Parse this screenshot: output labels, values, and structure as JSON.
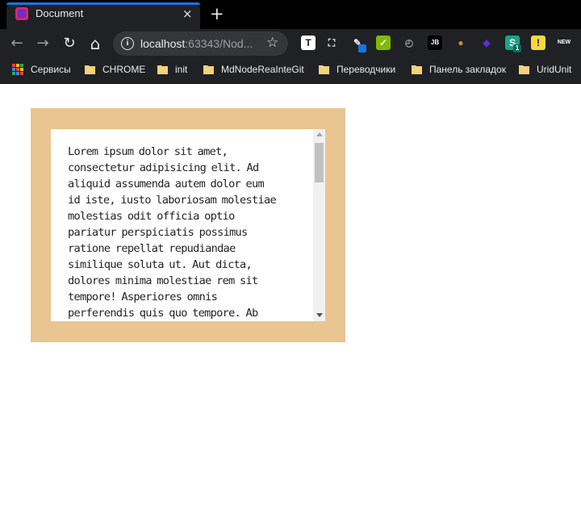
{
  "browser": {
    "tab": {
      "title": "Document",
      "close_icon": "×",
      "favicon": "intellij-icon"
    },
    "new_tab_icon": "+",
    "nav": {
      "back_icon": "←",
      "forward_icon": "→",
      "reload_icon": "↻",
      "home_icon": "⌂"
    },
    "address": {
      "info_icon": "i",
      "host": "localhost",
      "rest": ":63343/Nod...",
      "star_icon": "☆"
    },
    "extensions": [
      {
        "name": "text-extension-icon",
        "color": "#ffffff",
        "glyph": "T",
        "text_color": "#202124"
      },
      {
        "name": "screenshot-extension-icon",
        "color": "#202124",
        "glyph": "⛶",
        "text_color": "#e8eaed"
      },
      {
        "name": "eyedropper-extension-icon",
        "color": "#202124",
        "glyph": "✎",
        "text_color": "#e8eaed",
        "badge": "",
        "badge_color": "#1a73e8"
      },
      {
        "name": "evernote-extension-icon",
        "color": "#7fba00",
        "glyph": "✓",
        "text_color": "#ffffff"
      },
      {
        "name": "clock-extension-icon",
        "color": "#202124",
        "glyph": "◴",
        "text_color": "#9aa0a6"
      },
      {
        "name": "jetbrains-extension-icon",
        "color": "#000000",
        "glyph": "JB",
        "text_color": "#ffffff"
      },
      {
        "name": "cookie-extension-icon",
        "color": "#202124",
        "glyph": "●",
        "text_color": "#c48a3a"
      },
      {
        "name": "cube-extension-icon",
        "color": "#202124",
        "glyph": "◆",
        "text_color": "#5a2ed0"
      },
      {
        "name": "s-extension-icon",
        "color": "#1aa58a",
        "glyph": "S",
        "text_color": "#ffffff",
        "badge": "1",
        "badge_color": "#0b6b58"
      },
      {
        "name": "yellow-extension-icon",
        "color": "#f5d742",
        "glyph": "!",
        "text_color": "#202124"
      },
      {
        "name": "new-extension-icon",
        "color": "#202124",
        "glyph": "NEW",
        "text_color": "#ffffff"
      }
    ],
    "bookmarks": [
      {
        "label": "Сервисы",
        "icon": "apps-grid-icon"
      },
      {
        "label": "CHROME",
        "icon": "folder-icon"
      },
      {
        "label": "init",
        "icon": "folder-icon"
      },
      {
        "label": "MdNodeReaInteGit",
        "icon": "folder-icon"
      },
      {
        "label": "Переводчики",
        "icon": "folder-icon"
      },
      {
        "label": "Панель закладок",
        "icon": "folder-icon"
      },
      {
        "label": "UridUnit",
        "icon": "folder-icon"
      }
    ]
  },
  "page": {
    "colors": {
      "outer": "#e8c591",
      "inner": "#ffffff"
    },
    "lorem_lines": [
      "Lorem ipsum dolor sit amet,",
      "consectetur adipisicing elit. Ad",
      "aliquid assumenda autem dolor eum",
      "id iste, iusto laboriosam molestiae",
      "molestias odit officia optio",
      "pariatur perspiciatis possimus",
      "ratione repellat repudiandae",
      "similique soluta ut. Aut dicta,",
      "dolores minima molestiae rem sit",
      "tempore! Asperiores omnis",
      "perferendis quis quo tempore. Ab"
    ]
  }
}
